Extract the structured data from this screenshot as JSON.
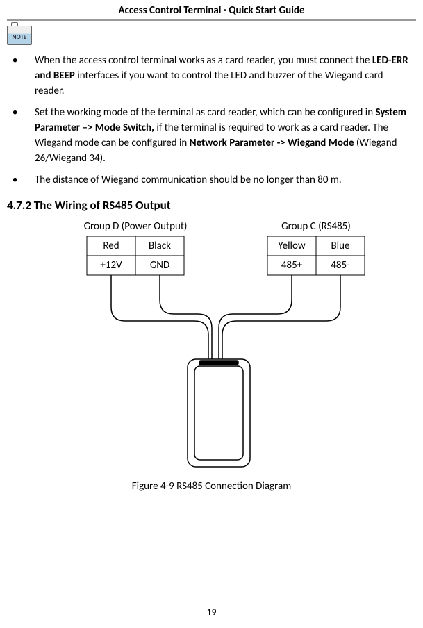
{
  "header": {
    "title": "Access Control Terminal · Quick Start Guide"
  },
  "noteIcon": {
    "label": "NOTE"
  },
  "bullets": [
    {
      "segments": [
        {
          "t": "When the access control terminal works as a card reader, you must connect the ",
          "b": false
        },
        {
          "t": "LED-ERR and BEEP",
          "b": true
        },
        {
          "t": " interfaces if you want to control the LED and buzzer of the Wiegand card reader.",
          "b": false
        }
      ]
    },
    {
      "segments": [
        {
          "t": "Set the working mode of the terminal as card reader, which can be configured in ",
          "b": false
        },
        {
          "t": "System Parameter –> Mode Switch,",
          "b": true
        },
        {
          "t": " if the terminal is required to work as a card reader. The Wiegand mode can be configured in ",
          "b": false
        },
        {
          "t": "Network Parameter -> Wiegand Mode",
          "b": true
        },
        {
          "t": " (Wiegand 26/Wiegand 34).",
          "b": false
        }
      ]
    },
    {
      "segments": [
        {
          "t": "The distance of Wiegand communication should be no longer than 80 m.",
          "b": false
        }
      ]
    }
  ],
  "section": {
    "heading": "4.7.2 The Wiring of RS485 Output"
  },
  "diagram": {
    "groupD": {
      "title": "Group D (Power Output)",
      "cells": [
        "Red",
        "Black",
        "+12V",
        "GND"
      ]
    },
    "groupC": {
      "title": "Group C (RS485)",
      "cells": [
        "Yellow",
        "Blue",
        "485+",
        "485-"
      ]
    }
  },
  "figure": {
    "caption": "Figure 4-9 RS485 Connection Diagram"
  },
  "page": {
    "number": "19"
  }
}
